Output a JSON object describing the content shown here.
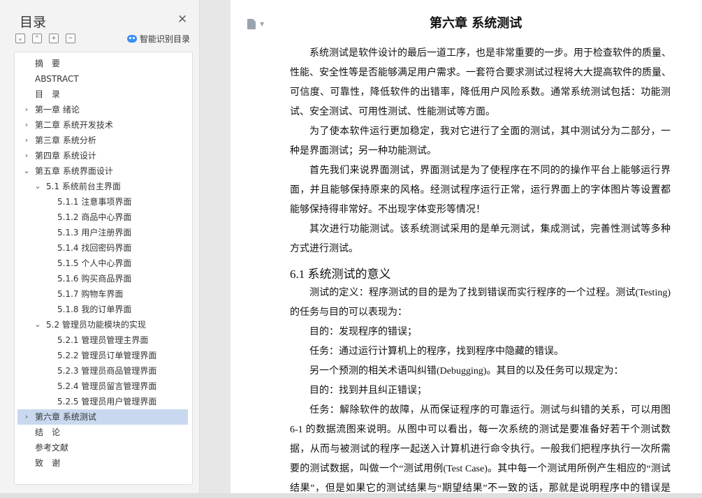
{
  "nav": {
    "title": "目录",
    "smart_label": "智能识别目录",
    "tools": [
      "⌄",
      "⌃",
      "+",
      "−"
    ],
    "items": [
      {
        "label": "摘　要",
        "level": 0,
        "chev": ""
      },
      {
        "label": "ABSTRACT",
        "level": 0,
        "chev": ""
      },
      {
        "label": "目　录",
        "level": 0,
        "chev": ""
      },
      {
        "label": "第一章  绪论",
        "level": 0,
        "chev": "›"
      },
      {
        "label": "第二章  系统开发技术",
        "level": 0,
        "chev": "›"
      },
      {
        "label": "第三章  系统分析",
        "level": 0,
        "chev": "›"
      },
      {
        "label": "第四章  系统设计",
        "level": 0,
        "chev": "›"
      },
      {
        "label": "第五章  系统界面设计",
        "level": 0,
        "chev": "⌄"
      },
      {
        "label": "5.1  系统前台主界面",
        "level": 1,
        "chev": "⌄"
      },
      {
        "label": "5.1.1  注意事项界面",
        "level": 2,
        "chev": ""
      },
      {
        "label": "5.1.2  商品中心界面",
        "level": 2,
        "chev": ""
      },
      {
        "label": "5.1.3  用户注册界面",
        "level": 2,
        "chev": ""
      },
      {
        "label": "5.1.4  找回密码界面",
        "level": 2,
        "chev": ""
      },
      {
        "label": "5.1.5  个人中心界面",
        "level": 2,
        "chev": ""
      },
      {
        "label": "5.1.6  购买商品界面",
        "level": 2,
        "chev": ""
      },
      {
        "label": "5.1.7  购物车界面",
        "level": 2,
        "chev": ""
      },
      {
        "label": "5.1.8  我的订单界面",
        "level": 2,
        "chev": ""
      },
      {
        "label": "5.2 管理员功能模块的实现",
        "level": 1,
        "chev": "⌄"
      },
      {
        "label": "5.2.1  管理员管理主界面",
        "level": 2,
        "chev": ""
      },
      {
        "label": "5.2.2  管理员订单管理界面",
        "level": 2,
        "chev": ""
      },
      {
        "label": "5.2.3  管理员商品管理界面",
        "level": 2,
        "chev": ""
      },
      {
        "label": "5.2.4  管理员留言管理界面",
        "level": 2,
        "chev": ""
      },
      {
        "label": "5.2.5  管理员用户管理界面",
        "level": 2,
        "chev": ""
      },
      {
        "label": "第六章  系统测试",
        "level": 0,
        "chev": "›",
        "selected": true
      },
      {
        "label": "结　论",
        "level": 0,
        "chev": ""
      },
      {
        "label": "参考文献",
        "level": 0,
        "chev": ""
      },
      {
        "label": "致　谢",
        "level": 0,
        "chev": ""
      }
    ]
  },
  "document": {
    "chapter_title": "第六章  系统测试",
    "section_heading": "6.1 系统测试的意义",
    "lines": [
      {
        "text": "系统测试是软件设计的最后一道工序，也是非常重要的一步。用于检查软件的质量、",
        "indent": true
      },
      {
        "text": "性能、安全性等是否能够满足用户需求。一套符合要求测试过程将大大提高软件的质量、",
        "indent": false
      },
      {
        "text": "可信度、可靠性，降低软件的出错率，降低用户风险系数。通常系统测试包括：功能测",
        "indent": false
      },
      {
        "text": "试、安全测试、可用性测试、性能测试等方面。",
        "indent": false,
        "last": true
      },
      {
        "text": "为了使本软件运行更加稳定，我对它进行了全面的测试，其中测试分为二部分，一",
        "indent": true
      },
      {
        "text": "种是界面测试；另一种功能测试。",
        "indent": false,
        "last": true
      },
      {
        "text": "首先我们来说界面测试，界面测试是为了使程序在不同的的操作平台上能够运行界",
        "indent": true
      },
      {
        "text": "面，并且能够保持原来的风格。经测试程序运行正常，运行界面上的字体图片等设置都",
        "indent": false
      },
      {
        "text": "能够保持得非常好。不出现字体变形等情况！",
        "indent": false,
        "last": true
      },
      {
        "text": "其次进行功能测试。该系统测试采用的是单元测试，集成测试，完善性测试等多种",
        "indent": true
      },
      {
        "text": "方式进行测试。",
        "indent": false,
        "last": true
      },
      {
        "text": "测试的定义：程序测试的目的是为了找到错误而实行程序的一个过程。测试(Testing)",
        "indent": true
      },
      {
        "text": "的任务与目的可以表现为：",
        "indent": false,
        "last": true
      },
      {
        "text": "目的：发现程序的错误；",
        "indent": true,
        "last": true
      },
      {
        "text": "任务：通过运行计算机上的程序，找到程序中隐藏的错误。",
        "indent": true,
        "last": true
      },
      {
        "text": "另一个预测的相关术语叫纠错(Debugging)。其目的以及任务可以规定为：",
        "indent": true,
        "last": true
      },
      {
        "text": "目的：找到并且纠正错误；",
        "indent": true,
        "last": true
      },
      {
        "text": "任务：解除软件的故障，从而保证程序的可靠运行。测试与纠错的关系，可以用图",
        "indent": true
      },
      {
        "text": "6-1 的数据流图来说明。从图中可以看出，每一次系统的测试是要准备好若干个测试数",
        "indent": false
      },
      {
        "text": "据，从而与被测试的程序一起送入计算机进行命令执行。一般我们把程序执行一次所需",
        "indent": false
      },
      {
        "text": "要的测试数据，叫做一个“测试用例(Test Case)。其中每一个测试用所例产生相应的“测试",
        "indent": false
      },
      {
        "text": "结果”，但是如果它的测试结果与“期望结果”不一致的话，那就是说明程序中的错误是",
        "indent": false
      }
    ]
  }
}
